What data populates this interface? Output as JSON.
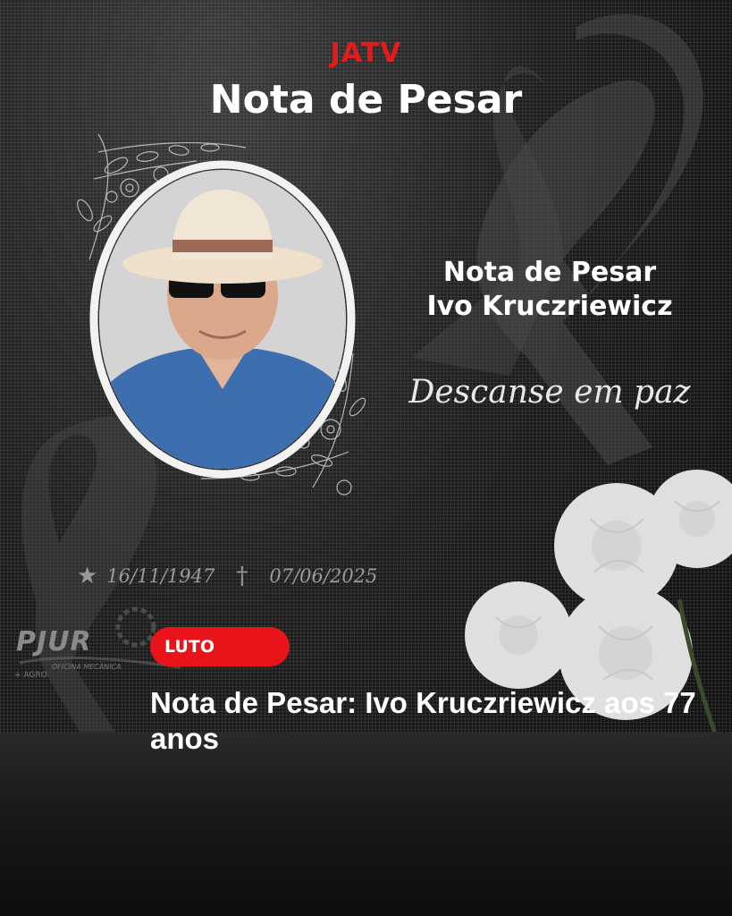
{
  "header": {
    "brand": "JATV",
    "headline": "Nota de Pesar"
  },
  "memorial": {
    "line1": "Nota de Pesar",
    "line2": "Ivo Kruczriewicz",
    "message": "Descanse em paz",
    "birth_date": "16/11/1947",
    "death_date": "07/06/2025",
    "birth_symbol": "★",
    "death_symbol": "†"
  },
  "sponsor": {
    "name": "PJUR",
    "sub": "OFICINA MECÂNICA",
    "sub2": "+ AGRO"
  },
  "article": {
    "category": "LUTO",
    "title": "Nota de Pesar: Ivo Kruczriewicz aos 77 anos"
  },
  "colors": {
    "brand": "#e31b1b",
    "tag": "#e8141a",
    "background": "#1c1c1c"
  }
}
